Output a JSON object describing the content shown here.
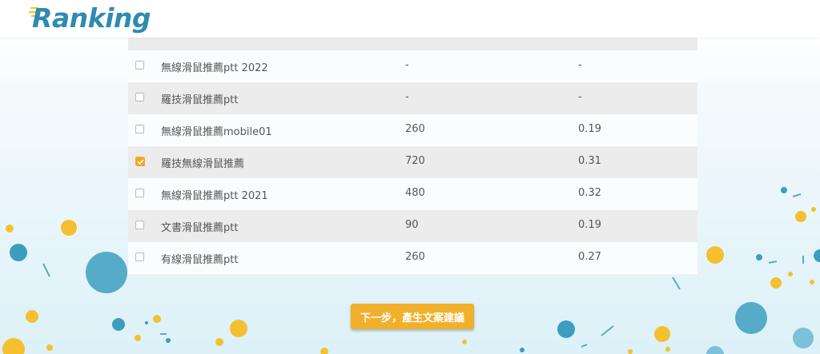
{
  "header": {
    "logo_text": "Ranking"
  },
  "table": {
    "rows": [
      {
        "keyword": "無線滑鼠推薦ptt 2022",
        "volume": "-",
        "cpc": "-",
        "checked": false
      },
      {
        "keyword": "羅技滑鼠推薦ptt",
        "volume": "-",
        "cpc": "-",
        "checked": false
      },
      {
        "keyword": "無線滑鼠推薦mobile01",
        "volume": "260",
        "cpc": "0.19",
        "checked": false
      },
      {
        "keyword": "羅技無線滑鼠推薦",
        "volume": "720",
        "cpc": "0.31",
        "checked": true
      },
      {
        "keyword": "無線滑鼠推薦ptt 2021",
        "volume": "480",
        "cpc": "0.32",
        "checked": false
      },
      {
        "keyword": "文書滑鼠推薦ptt",
        "volume": "90",
        "cpc": "0.19",
        "checked": false
      },
      {
        "keyword": "有線滑鼠推薦ptt",
        "volume": "260",
        "cpc": "0.27",
        "checked": false
      }
    ]
  },
  "actions": {
    "next_label": "下一步，產生文案建議"
  },
  "colors": {
    "brand": "#2f8bb0",
    "accent": "#f0b02c",
    "checkbox_checked": "#f0a829"
  }
}
